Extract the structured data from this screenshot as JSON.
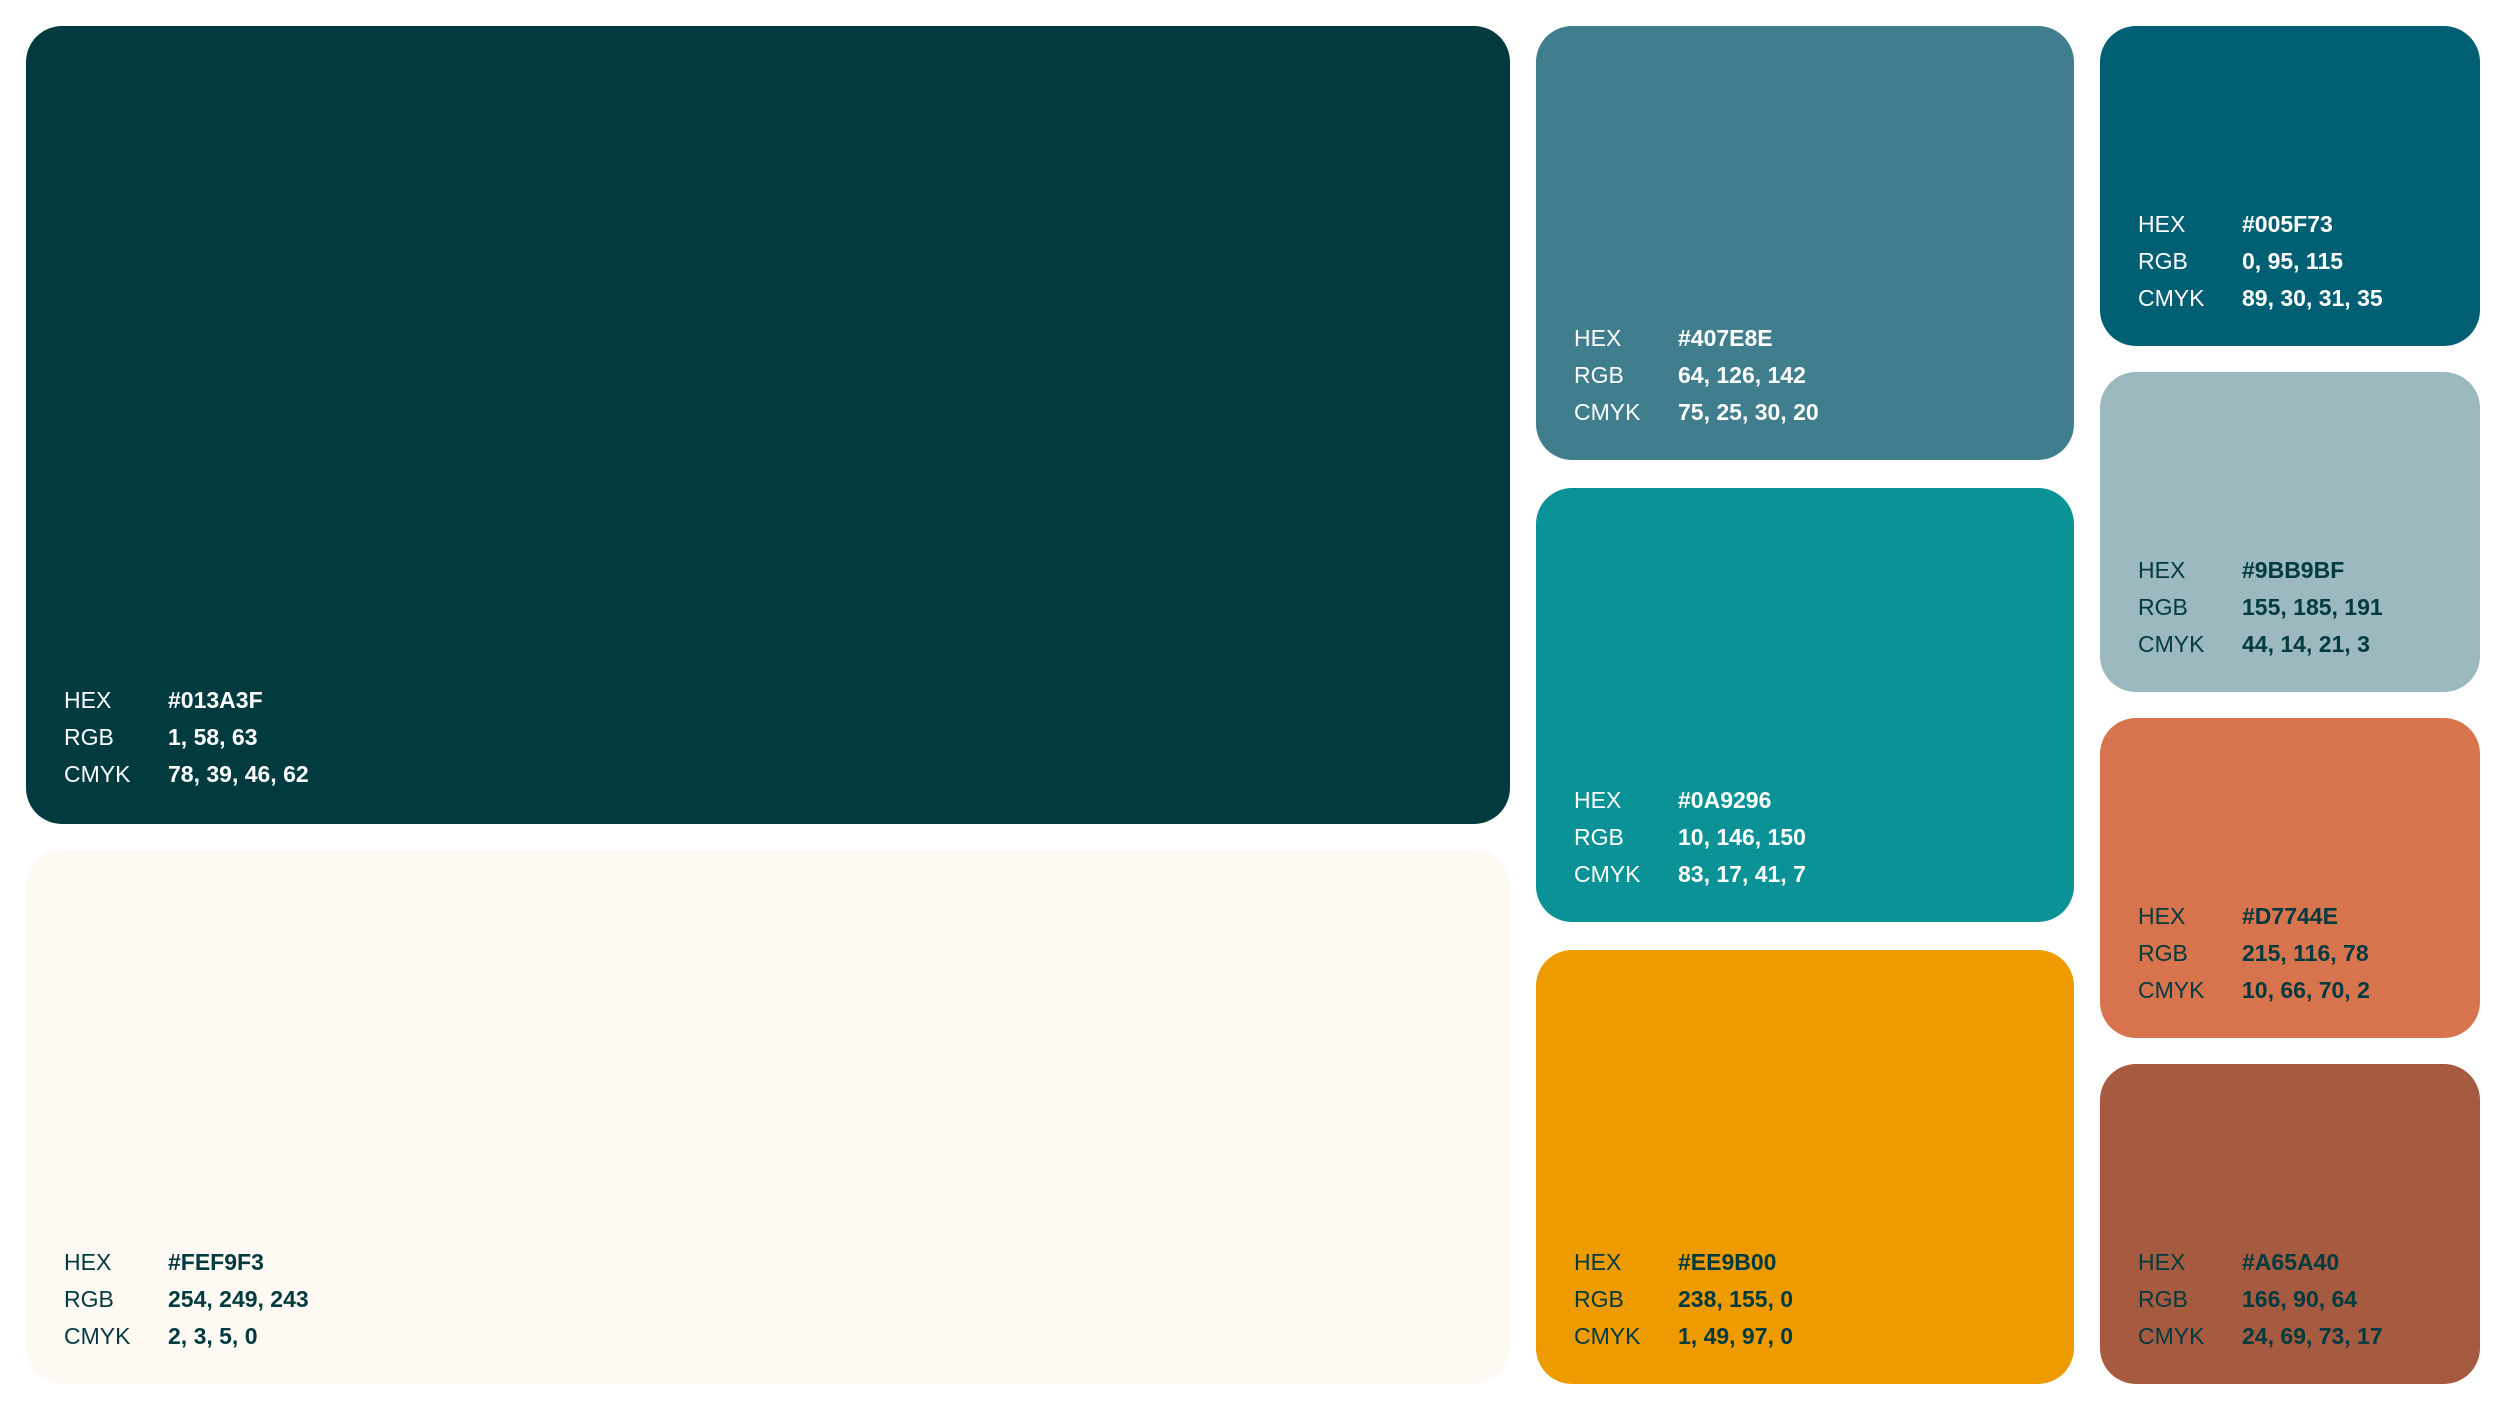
{
  "swatches": [
    {
      "hex": "#013A3F",
      "rgb": "1, 58, 63",
      "cmyk": "78, 39, 46, 62"
    },
    {
      "hex": "#FEF9F3",
      "rgb": "254, 249, 243",
      "cmyk": "2, 3, 5, 0"
    },
    {
      "hex": "#407E8E",
      "rgb": "64, 126, 142",
      "cmyk": "75, 25, 30, 20"
    },
    {
      "hex": "#0A9296",
      "rgb": "10, 146, 150",
      "cmyk": "83, 17, 41, 7"
    },
    {
      "hex": "#EE9B00",
      "rgb": "238, 155, 0",
      "cmyk": "1, 49, 97, 0"
    },
    {
      "hex": "#005F73",
      "rgb": "0, 95, 115",
      "cmyk": "89, 30, 31, 35"
    },
    {
      "hex": "#9BB9BF",
      "rgb": "155, 185, 191",
      "cmyk": "44, 14, 21, 3"
    },
    {
      "hex": "#D7744E",
      "rgb": "215, 116, 78",
      "cmyk": "10, 66, 70, 2"
    },
    {
      "hex": "#A65A40",
      "rgb": "166, 90, 64",
      "cmyk": "24, 69, 73, 17"
    }
  ],
  "labels": {
    "hex": "HEX",
    "rgb": "RGB",
    "cmyk": "CMYK"
  }
}
